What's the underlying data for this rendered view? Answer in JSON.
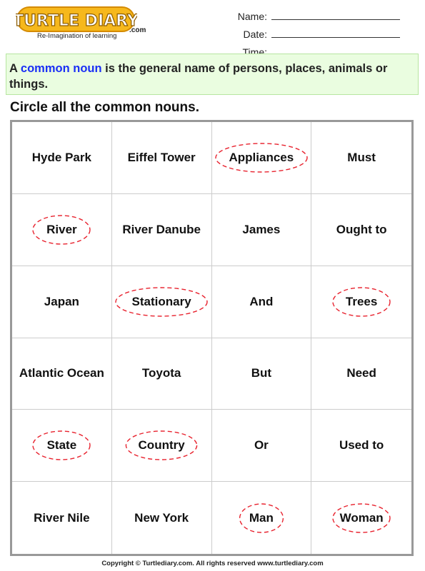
{
  "header": {
    "logo_text": "TURTLE DIARY",
    "logo_suffix": ".com",
    "tagline": "Re-Imagination of learning",
    "fields": [
      {
        "label": "Name:"
      },
      {
        "label": "Date:"
      },
      {
        "label": "Time:"
      }
    ]
  },
  "definition": {
    "prefix": "A",
    "highlight": "common noun",
    "rest": "is the general name of persons, places, animals or things."
  },
  "instruction": "Circle all the common nouns.",
  "colors": {
    "highlight": "#1a2ff5",
    "circle": "#e8222e",
    "definition_bg": "#eafde0"
  },
  "grid": {
    "rows": [
      [
        {
          "text": "Hyde Park",
          "circled": false
        },
        {
          "text": "Eiffel Tower",
          "circled": false
        },
        {
          "text": "Appliances",
          "circled": true
        },
        {
          "text": "Must",
          "circled": false
        }
      ],
      [
        {
          "text": "River",
          "circled": true
        },
        {
          "text": "River Danube",
          "circled": false
        },
        {
          "text": "James",
          "circled": false
        },
        {
          "text": "Ought to",
          "circled": false
        }
      ],
      [
        {
          "text": "Japan",
          "circled": false
        },
        {
          "text": "Stationary",
          "circled": true
        },
        {
          "text": "And",
          "circled": false
        },
        {
          "text": "Trees",
          "circled": true
        }
      ],
      [
        {
          "text": "Atlantic Ocean",
          "circled": false
        },
        {
          "text": "Toyota",
          "circled": false
        },
        {
          "text": "But",
          "circled": false
        },
        {
          "text": "Need",
          "circled": false
        }
      ],
      [
        {
          "text": "State",
          "circled": true
        },
        {
          "text": "Country",
          "circled": true
        },
        {
          "text": "Or",
          "circled": false
        },
        {
          "text": "Used to",
          "circled": false
        }
      ],
      [
        {
          "text": "River Nile",
          "circled": false
        },
        {
          "text": "New York",
          "circled": false
        },
        {
          "text": "Man",
          "circled": true
        },
        {
          "text": "Woman",
          "circled": true
        }
      ]
    ]
  },
  "footer": "Copyright © Turtlediary.com. All rights reserved  www.turtlediary.com"
}
